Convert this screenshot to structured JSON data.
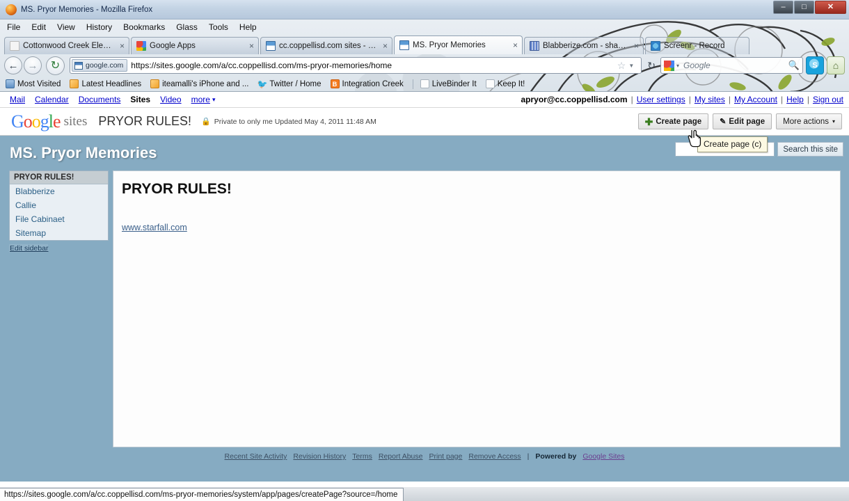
{
  "window": {
    "title": "MS. Pryor Memories - Mozilla Firefox",
    "minimize_label": "–",
    "maximize_label": "❐",
    "close_label": "✕"
  },
  "menubar": {
    "items": [
      {
        "label": "File"
      },
      {
        "label": "Edit"
      },
      {
        "label": "View"
      },
      {
        "label": "History"
      },
      {
        "label": "Bookmarks"
      },
      {
        "label": "Glass"
      },
      {
        "label": "Tools"
      },
      {
        "label": "Help"
      }
    ]
  },
  "tabs": [
    {
      "label": "Cottonwood Creek Element...",
      "icon": "page-icon",
      "active": false,
      "close": "×"
    },
    {
      "label": "Google Apps",
      "icon": "google-apps-icon",
      "active": false,
      "close": "×"
    },
    {
      "label": "cc.coppellisd.com sites - Go...",
      "icon": "sites-icon",
      "active": false,
      "close": "×"
    },
    {
      "label": "MS. Pryor Memories",
      "icon": "sites-icon",
      "active": true,
      "close": "×"
    },
    {
      "label": "Blabberize.com - share: Dave",
      "icon": "blabberize-icon",
      "active": false,
      "close": "×"
    },
    {
      "label": "Screenr - Record",
      "icon": "screenr-icon",
      "active": false,
      "close": ""
    }
  ],
  "navbar": {
    "back_icon": "←",
    "forward_icon": "→",
    "reload_icon": "↻",
    "identity_chip": "google.com",
    "url": "https://sites.google.com/a/cc.coppellisd.com/ms-pryor-memories/home",
    "star_icon": "☆",
    "dropmarker_icon": "▼",
    "reload2_icon": "↻",
    "search_placeholder": "Google",
    "search_value": "",
    "magnifier_icon": "⚲",
    "skype_icon": "S",
    "home_icon": "⌂"
  },
  "bookmarks": [
    {
      "label": "Most Visited",
      "icon": "most-visited-icon"
    },
    {
      "label": "Latest Headlines",
      "icon": "rss-icon"
    },
    {
      "label": "iteamalli's iPhone and ...",
      "icon": "rss-icon"
    },
    {
      "label": "Twitter / Home",
      "icon": "twitter-icon"
    },
    {
      "label": "Integration Creek",
      "icon": "blogger-icon"
    },
    {
      "label": "LiveBinder It",
      "icon": "page-icon"
    },
    {
      "label": "Keep It!",
      "icon": "page-icon"
    }
  ],
  "gbar": {
    "links": [
      "Mail",
      "Calendar",
      "Documents"
    ],
    "current": "Sites",
    "video": "Video",
    "more": "more",
    "more_caret": "▾",
    "email": "apryor@cc.coppellisd.com",
    "right_links": [
      "User settings",
      "My sites",
      "My Account",
      "Help",
      "Sign out"
    ],
    "separator": "|"
  },
  "sites_header": {
    "logo_letters": [
      {
        "ch": "G",
        "color": "b"
      },
      {
        "ch": "o",
        "color": "r"
      },
      {
        "ch": "o",
        "color": "y"
      },
      {
        "ch": "g",
        "color": "b"
      },
      {
        "ch": "l",
        "color": "g"
      },
      {
        "ch": "e",
        "color": "r"
      }
    ],
    "sites_word": "sites",
    "site_name": "PRYOR RULES!",
    "lock_icon": "🔒",
    "privacy_text": "Private to only me  Updated May 4, 2011 11:48 AM",
    "create_page_label": "Create page",
    "create_page_plus": "✚",
    "edit_page_label": "Edit page",
    "edit_page_pencil": "✎",
    "more_actions_label": "More actions",
    "more_actions_caret": "▾"
  },
  "tooltip": {
    "text": "Create page (c)"
  },
  "site": {
    "banner_title": "MS. Pryor Memories",
    "search_placeholder": "",
    "search_value": "",
    "search_button": "Search this site",
    "sidebar": {
      "header": "PRYOR RULES!",
      "items": [
        {
          "label": "Blabberize"
        },
        {
          "label": "Callie"
        },
        {
          "label": "File Cabinaet"
        },
        {
          "label": "Sitemap"
        }
      ],
      "edit_link": "Edit sidebar"
    },
    "content": {
      "title": "PRYOR RULES!",
      "link": "www.starfall.com"
    },
    "footer": {
      "links": [
        "Recent Site Activity",
        "Revision History",
        "Terms",
        "Report Abuse",
        "Print page",
        "Remove Access"
      ],
      "separator": "|",
      "powered_by": "Powered by",
      "powered_link": "Google Sites"
    }
  },
  "statusbar": {
    "url": "https://sites.google.com/a/cc.coppellisd.com/ms-pryor-memories/system/app/pages/createPage?source=/home"
  },
  "colors": {
    "site_background": "#86abc2",
    "sidebar_header": "#c5cdd2",
    "sidebar_box": "#e9eff4",
    "accent_link": "#0000cc",
    "tooltip_bg": "#fdf9e3"
  }
}
